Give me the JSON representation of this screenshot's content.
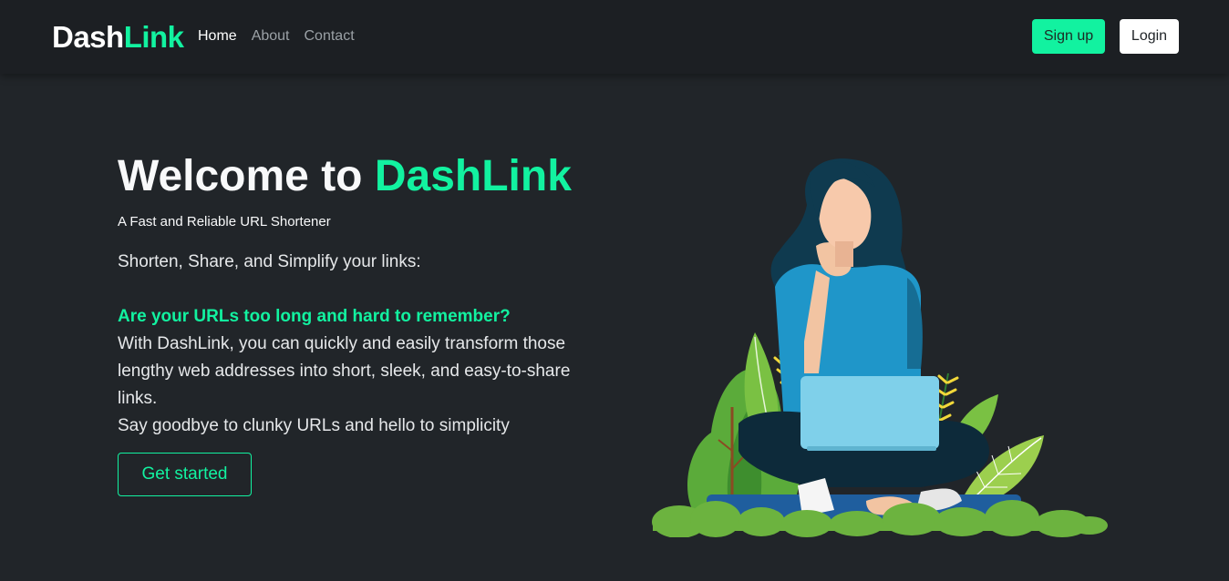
{
  "nav": {
    "brand_part1": "Dash",
    "brand_part2": "Link",
    "links": [
      "Home",
      "About",
      "Contact"
    ],
    "signup_label": "Sign up",
    "login_label": "Login"
  },
  "hero": {
    "title_part1": "Welcome to ",
    "title_part2": "DashLink",
    "subtitle": "A Fast and Reliable URL Shortener",
    "tagline": "Shorten, Share, and Simplify your links:",
    "question": "Are your URLs too long and hard to remember?",
    "paragraph": "With DashLink, you can quickly and easily transform those lengthy web addresses into short, sleek, and easy-to-share links.",
    "paragraph2": "Say goodbye to clunky URLs and hello to simplicity",
    "cta_label": "Get started"
  },
  "colors": {
    "background": "#212529",
    "navbar": "#1c1f23",
    "accent": "#12f2a0"
  },
  "illustration": {
    "icon": "woman-with-laptop-illustration"
  }
}
